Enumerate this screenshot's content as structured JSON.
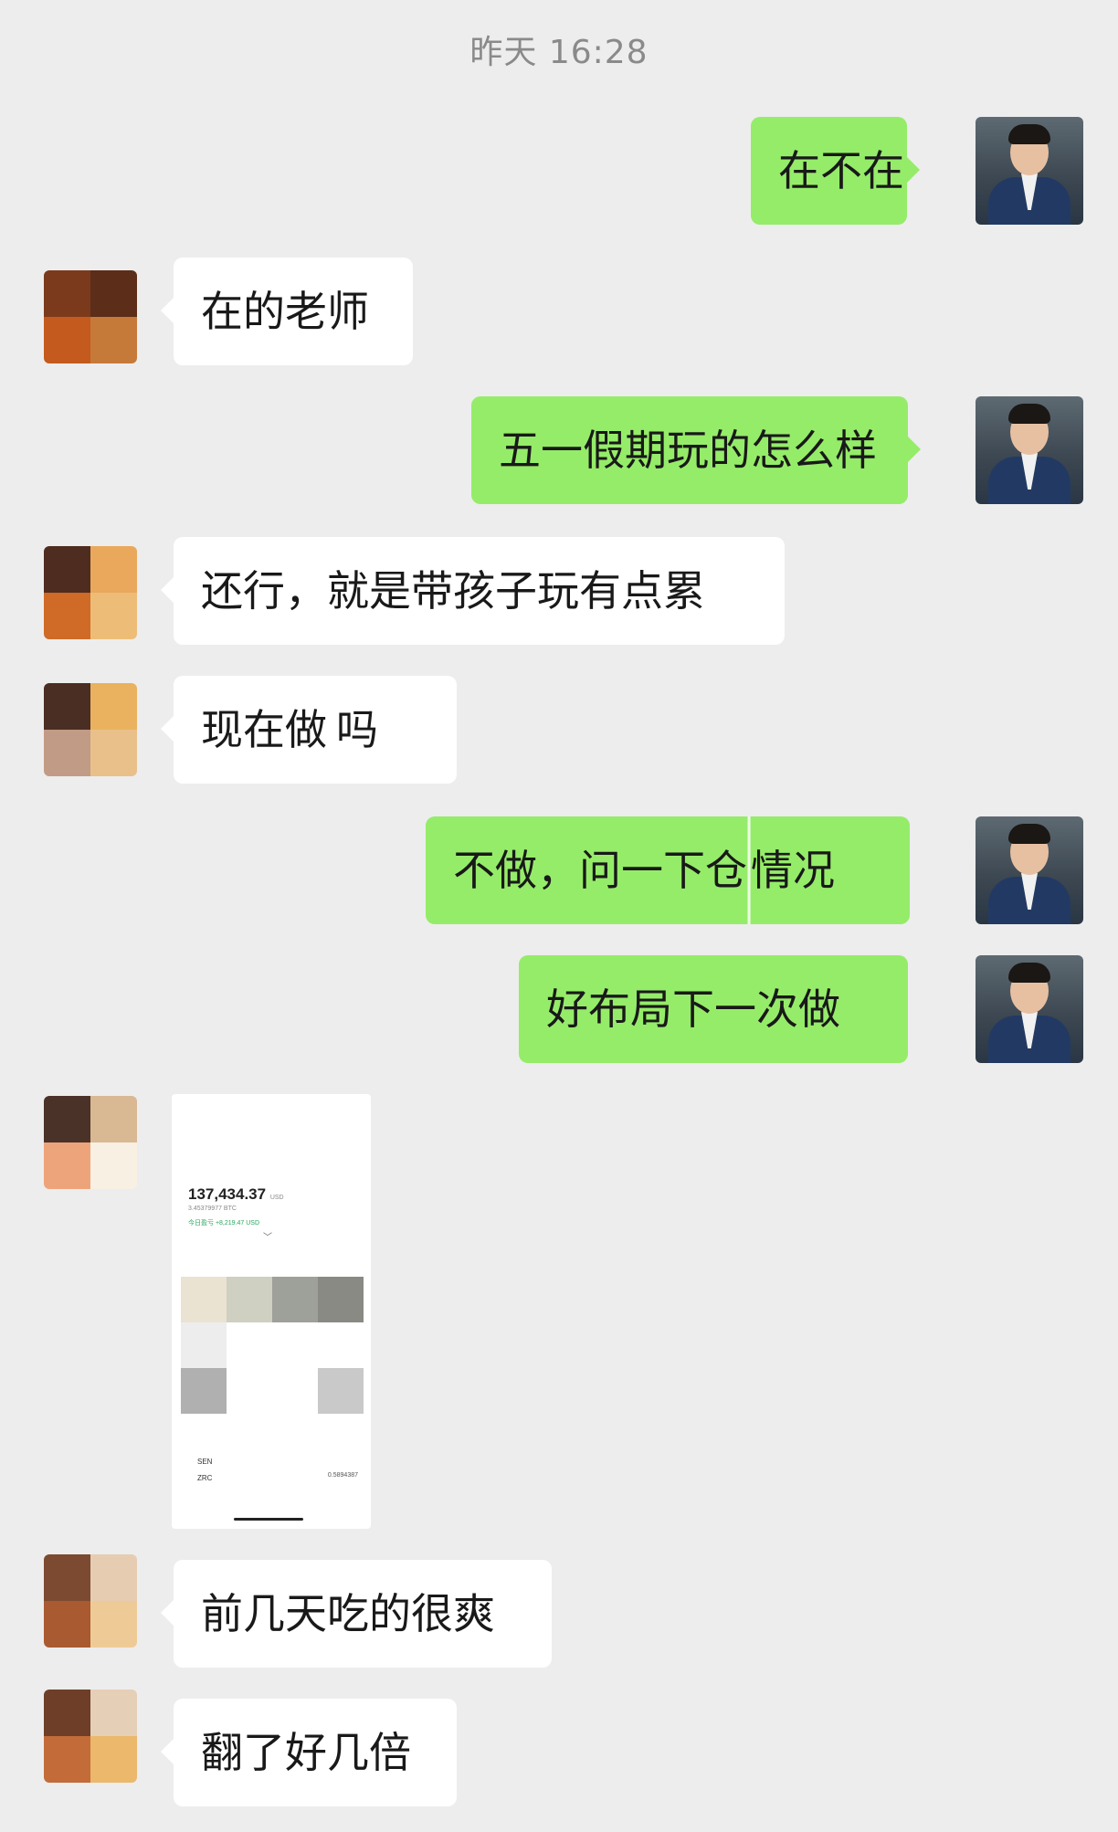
{
  "timestamp": "昨天 16:28",
  "messages": [
    {
      "from": "me",
      "text": "在不在"
    },
    {
      "from": "them",
      "text": "在的老师"
    },
    {
      "from": "me",
      "text": "五一假期玩的怎么样"
    },
    {
      "from": "them",
      "text": "还行，就是带孩子玩有点累"
    },
    {
      "from": "them",
      "text_a": "现在做",
      "text_b": "吗"
    },
    {
      "from": "me",
      "text_a": "不做，问一下仓",
      "text_b": "情况"
    },
    {
      "from": "me",
      "text": "好布局下一次做"
    },
    {
      "from": "them",
      "text": "前几天吃的很爽"
    },
    {
      "from": "them",
      "text": "翻了好几倍"
    }
  ],
  "screenshot": {
    "total": "137,434.37",
    "total_unit": "USD",
    "btc": "3.45379977 BTC",
    "today_gain": "今日盈亏 +8,219.47 USD",
    "coin1": "SEN",
    "coin2": "ZRC",
    "coin2_value": "0.5894387"
  },
  "colors": {
    "me_bubble": "#95ec69",
    "them_bubble": "#ffffff",
    "background": "#ededed",
    "timestamp": "#8a8a8a"
  },
  "avatar_colors": {
    "them1": [
      "#7b3a1c",
      "#5c2d18",
      "#c45a1e",
      "#c67a3a"
    ],
    "them2": [
      "#4e2c20",
      "#e9a85c",
      "#cf6a27",
      "#edbd78"
    ],
    "them3": [
      "#4a2e23",
      "#eab25e",
      "#c29b86",
      "#e9c08a"
    ],
    "them4": [
      "#4a3229",
      "#d9b894",
      "#eea47a",
      "#f8f0e2"
    ],
    "them5": [
      "#7b4a30",
      "#e6cdb2",
      "#a95a31",
      "#eecb96"
    ],
    "them6": [
      "#6e3e28",
      "#e5cfb7",
      "#c36c3a",
      "#ecb86c"
    ]
  }
}
